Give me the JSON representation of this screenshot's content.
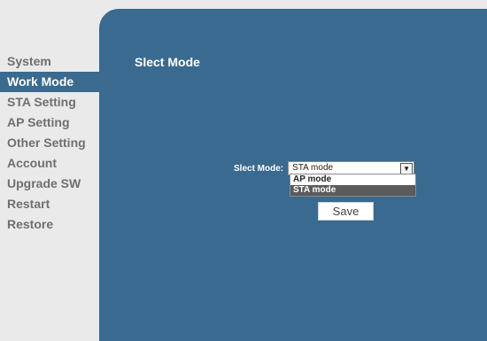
{
  "sidebar": {
    "items": [
      {
        "label": "System"
      },
      {
        "label": "Work Mode"
      },
      {
        "label": "STA Setting"
      },
      {
        "label": "AP Setting"
      },
      {
        "label": "Other Setting"
      },
      {
        "label": "Account"
      },
      {
        "label": "Upgrade SW"
      },
      {
        "label": "Restart"
      },
      {
        "label": "Restore"
      }
    ],
    "active": "Work Mode"
  },
  "main": {
    "title": "Slect Mode",
    "mode_label": "Slect Mode:",
    "mode_select": {
      "value": "STA mode",
      "options": [
        "AP mode",
        "STA mode"
      ],
      "highlighted": "STA mode"
    },
    "save_label": "Save"
  },
  "colors": {
    "panel": "#3a6a8f",
    "sidebar_bg": "#eaeaea",
    "sidebar_text": "#6f6f6f",
    "active_text": "#ffffff"
  }
}
